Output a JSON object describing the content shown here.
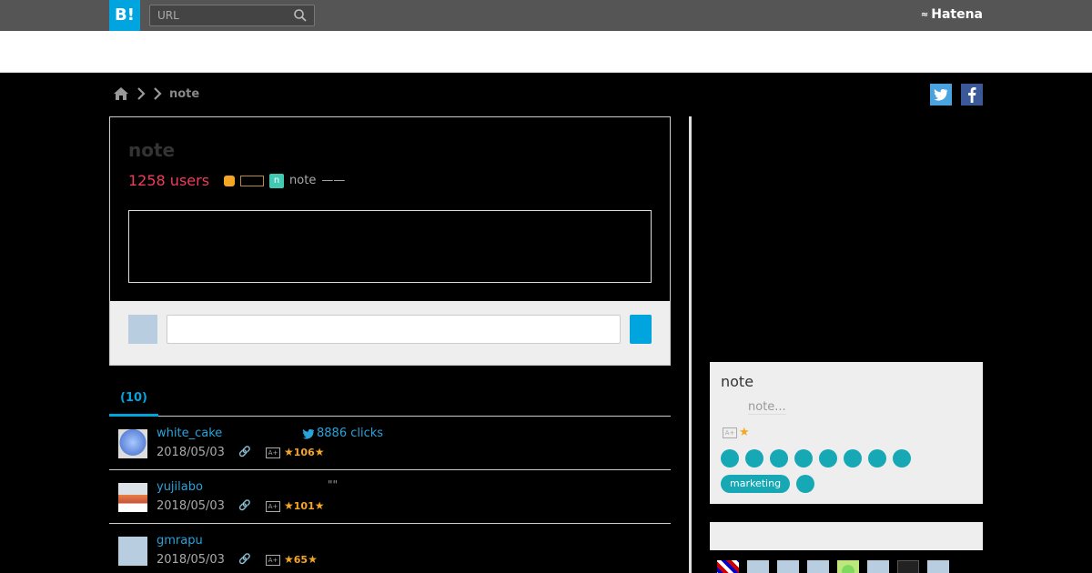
{
  "header": {
    "logo_text": "B!",
    "search_placeholder": "URL",
    "brand": "Hatena"
  },
  "breadcrumb": {
    "current": "note"
  },
  "entry": {
    "title": "note",
    "users": "1258 users",
    "note_icon_glyph": "n",
    "site": "note",
    "dash": "——"
  },
  "tabs": {
    "active": "(10)"
  },
  "bookmarks": [
    {
      "user": "white_cake",
      "date": "2018/05/03",
      "clicks": "8886 clicks",
      "stars": "106",
      "avatar": "av-ball"
    },
    {
      "user": "yujilabo",
      "comment": "\"\"",
      "date": "2018/05/03",
      "stars": "101",
      "avatar": "av-food"
    },
    {
      "user": "gmrapu",
      "date": "2018/05/03",
      "stars": "65",
      "avatar": "av-default"
    }
  ],
  "sidebar": {
    "title": "note",
    "description": "note...",
    "tag_label": "marketing"
  },
  "colors": {
    "accent": "#00a4de",
    "users": "#f03c5a",
    "tag": "#17a8b5",
    "star": "#f5a623"
  }
}
